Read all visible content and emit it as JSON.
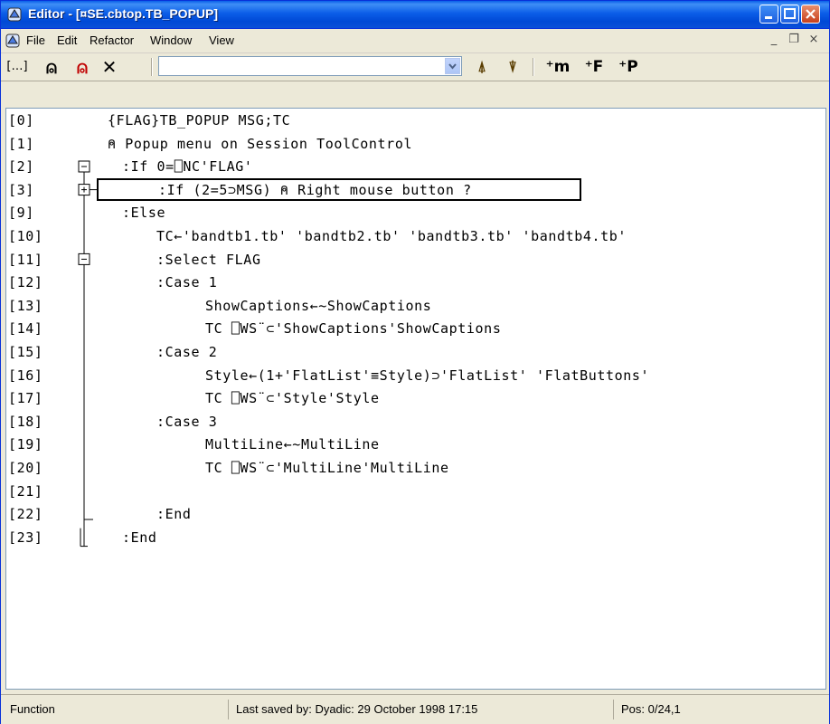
{
  "window": {
    "title": "Editor - [¤SE.cbtop.TB_POPUP]"
  },
  "menubar": {
    "items": [
      {
        "label": "File"
      },
      {
        "label": "Edit"
      },
      {
        "label": "Refactor"
      },
      {
        "label": "Window"
      },
      {
        "label": "View"
      }
    ],
    "mdi_min": "_",
    "mdi_restore": "❐",
    "mdi_close": "×"
  },
  "toolbar": {
    "buttons": [
      {
        "icon": "comment-block-icon",
        "glyph": "[…]"
      },
      {
        "icon": "comment-icon",
        "glyph": "⍝"
      },
      {
        "icon": "uncomment-icon",
        "glyph": "⍝"
      },
      {
        "icon": "delete-icon",
        "glyph": "✕"
      },
      {
        "icon": "search-icon",
        "glyph": "⍋"
      },
      {
        "icon": "replace-icon",
        "glyph": "⍒"
      },
      {
        "icon": "new-method-icon",
        "glyph": "⁺m"
      },
      {
        "icon": "new-function-icon",
        "glyph": "⁺F"
      },
      {
        "icon": "new-property-icon",
        "glyph": "⁺P"
      }
    ],
    "search_value": ""
  },
  "code": {
    "lines": [
      {
        "no": "[0]",
        "text": "{FLAG}TB_POPUP MSG;TC",
        "indent": 0
      },
      {
        "no": "[1]",
        "text": "⍝ Popup menu on Session ToolControl",
        "indent": 0
      },
      {
        "no": "[2]",
        "text": ":If 0=⎕NC'FLAG'",
        "indent": 0
      },
      {
        "no": "[3]",
        "text": ":If (2=5⊃MSG) ⍝ Right mouse button ?",
        "indent": 1
      },
      {
        "no": "[9]",
        "text": ":Else",
        "indent": 0
      },
      {
        "no": "[10]",
        "text": "TC←'bandtb1.tb' 'bandtb2.tb' 'bandtb3.tb' 'bandtb4.tb'",
        "indent": 1
      },
      {
        "no": "[11]",
        "text": ":Select FLAG",
        "indent": 1
      },
      {
        "no": "[12]",
        "text": ":Case 1",
        "indent": 1
      },
      {
        "no": "[13]",
        "text": "ShowCaptions←~ShowCaptions",
        "indent": 2
      },
      {
        "no": "[14]",
        "text": "TC ⎕WS¨⊂'ShowCaptions'ShowCaptions",
        "indent": 2
      },
      {
        "no": "[15]",
        "text": ":Case 2",
        "indent": 1
      },
      {
        "no": "[16]",
        "text": "Style←(1+'FlatList'≡Style)⊃'FlatList' 'FlatButtons'",
        "indent": 2
      },
      {
        "no": "[17]",
        "text": "TC ⎕WS¨⊂'Style'Style",
        "indent": 2
      },
      {
        "no": "[18]",
        "text": ":Case 3",
        "indent": 1
      },
      {
        "no": "[19]",
        "text": "MultiLine←~MultiLine",
        "indent": 2
      },
      {
        "no": "[20]",
        "text": "TC ⎕WS¨⊂'MultiLine'MultiLine",
        "indent": 2
      },
      {
        "no": "[21]",
        "text": "",
        "indent": 0
      },
      {
        "no": "[22]",
        "text": ":End",
        "indent": 1
      },
      {
        "no": "[23]",
        "text": ":End",
        "indent": 0
      }
    ]
  },
  "statusbar": {
    "type": "Function",
    "saved": "Last saved by: Dyadic: 29 October 1998 17:15",
    "pos": "Pos: 0/24,1"
  },
  "colors": {
    "titlebar": "#0a5fe8",
    "chrome": "#ece9d8",
    "editor_bg": "#ffffff"
  }
}
